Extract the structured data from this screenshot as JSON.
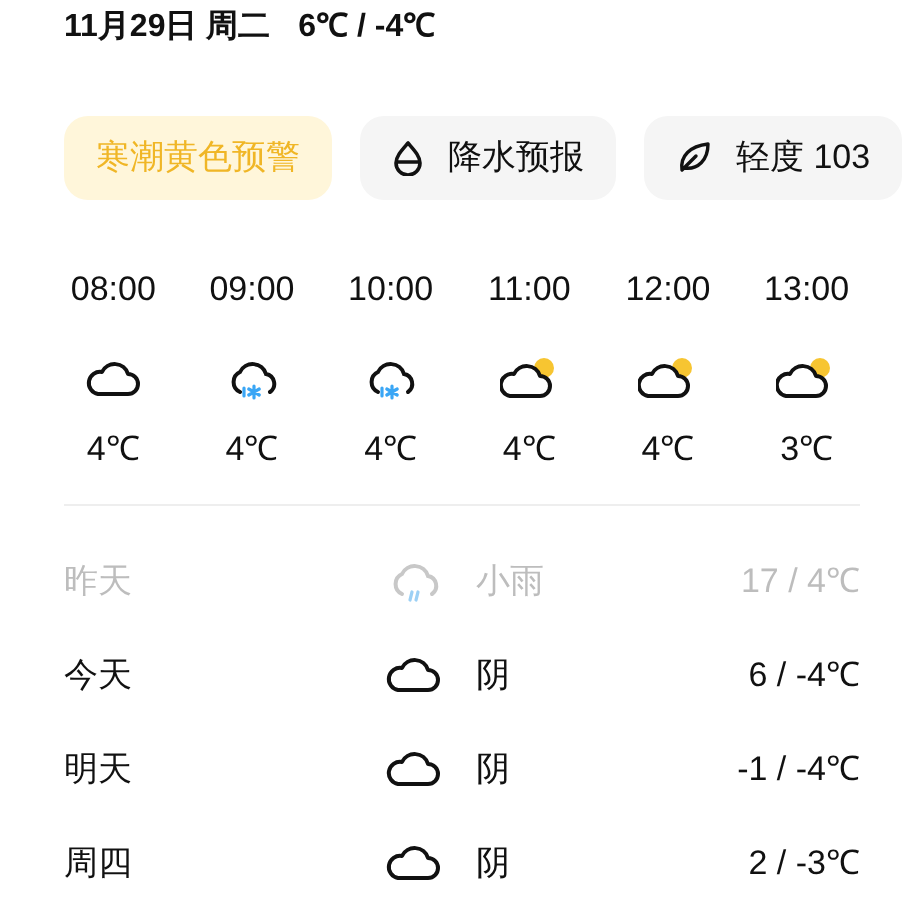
{
  "header": {
    "date": "11月29日 周二",
    "temps": "6℃ / -4℃"
  },
  "chips": [
    {
      "label": "寒潮黄色预警",
      "kind": "alert"
    },
    {
      "label": "降水预报",
      "kind": "rain"
    },
    {
      "label": "轻度 103",
      "kind": "air"
    }
  ],
  "hourly": [
    {
      "time": "08:00",
      "kind": "cloudy",
      "temp": "4℃"
    },
    {
      "time": "09:00",
      "kind": "snow",
      "temp": "4℃"
    },
    {
      "time": "10:00",
      "kind": "snow",
      "temp": "4℃"
    },
    {
      "time": "11:00",
      "kind": "partly",
      "temp": "4℃"
    },
    {
      "time": "12:00",
      "kind": "partly",
      "temp": "4℃"
    },
    {
      "time": "13:00",
      "kind": "partly",
      "temp": "3℃"
    }
  ],
  "daily": [
    {
      "day": "昨天",
      "kind": "rain",
      "condition": "小雨",
      "range": "17 / 4℃",
      "past": true
    },
    {
      "day": "今天",
      "kind": "cloudy",
      "condition": "阴",
      "range": "6 / -4℃",
      "past": false
    },
    {
      "day": "明天",
      "kind": "cloudy",
      "condition": "阴",
      "range": "-1 / -4℃",
      "past": false
    },
    {
      "day": "周四",
      "kind": "cloudy",
      "condition": "阴",
      "range": "2 / -3℃",
      "past": false
    }
  ]
}
